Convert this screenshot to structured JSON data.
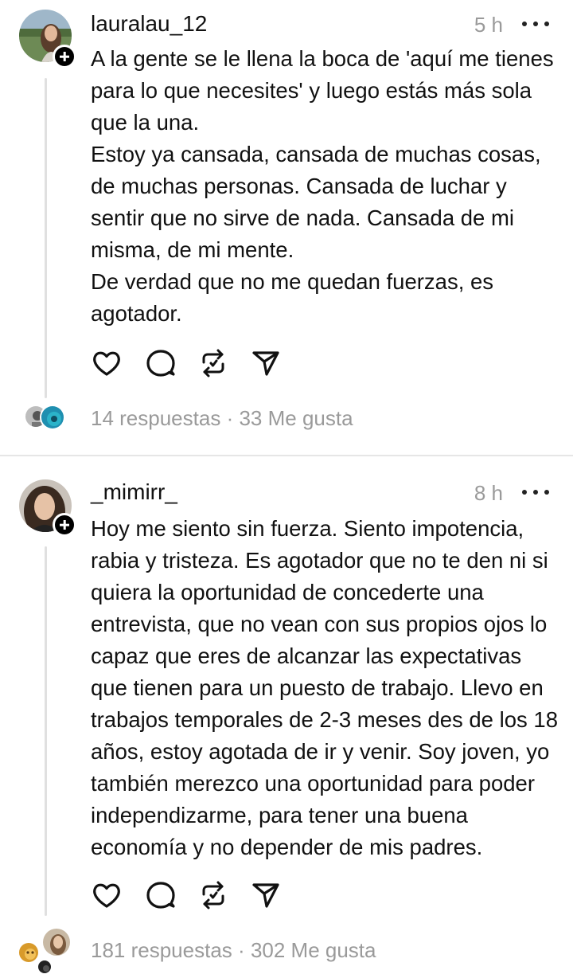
{
  "posts": [
    {
      "username": "lauralau_12",
      "time": "5 h",
      "paragraphs": [
        "A la gente se le llena la boca de 'aquí me tienes para lo que necesites' y luego estás más sola que la una.",
        "Estoy ya cansada, cansada de muchas cosas, de muchas personas. Cansada de luchar y sentir que no sirve de nada. Cansada de mi misma, de mi mente.",
        "De verdad que no me quedan fuerzas, es agotador."
      ],
      "replies": "14 respuestas",
      "separator": "·",
      "likes": "33 Me gusta"
    },
    {
      "username": "_mimirr_",
      "time": "8 h",
      "paragraphs": [
        "Hoy me siento sin fuerza. Siento impotencia, rabia y tristeza. Es agotador que no te den ni si quiera la oportunidad de concederte una entrevista, que no vean con sus propios ojos lo capaz que eres de alcanzar las expectativas que tienen para un puesto de trabajo. Llevo en trabajos temporales de 2-3 meses des de los 18 años, estoy agotada de ir y venir. Soy joven, yo también merezco una oportunidad para poder independizarme, para tener una buena economía y no depender de mis padres."
      ],
      "replies": "181 respuestas",
      "separator": "·",
      "likes": "302 Me gusta"
    }
  ],
  "icons": {
    "like": "heart-icon",
    "comment": "comment-icon",
    "repost": "repost-icon",
    "share": "send-icon",
    "more": "more-icon",
    "follow": "follow-plus-icon"
  },
  "colors": {
    "text": "#111111",
    "muted": "#9a9a9a",
    "divider": "#e6e6e6",
    "thread_line": "#e0e0e0"
  }
}
